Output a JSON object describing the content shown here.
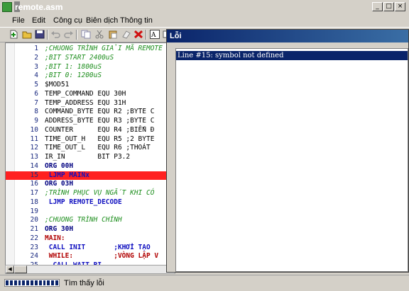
{
  "window": {
    "title": "remote.asm"
  },
  "menu": [
    "File",
    "Edit",
    "Công cụ",
    "Biên dịch",
    "Thông tin"
  ],
  "toolbar": {
    "icons": [
      "new-file-icon",
      "open-folder-icon",
      "save-icon",
      "undo-icon",
      "redo-icon",
      "copy-icon",
      "cut-icon",
      "paste-icon",
      "erase-icon",
      "delete-icon",
      "font-icon",
      "view-icon"
    ]
  },
  "editor": {
    "highlighted_line": 15,
    "lines": [
      {
        "n": "1",
        "t": ";CHUONG TRÌNH GIẢI MÃ REMOTE",
        "s": "cmt"
      },
      {
        "n": "2",
        "t": ";BIT START 2400uS",
        "s": "cmt"
      },
      {
        "n": "3",
        "t": ";BIT 1: 1800uS",
        "s": "cmt"
      },
      {
        "n": "4",
        "t": ";BIT 0: 1200uS",
        "s": "cmt"
      },
      {
        "n": "5",
        "t": "$MOD51",
        "s": "plain"
      },
      {
        "n": "6",
        "t": "TEMP_COMMAND EQU 30H",
        "s": "plain"
      },
      {
        "n": "7",
        "t": "TEMP_ADDRESS EQU 31H",
        "s": "plain"
      },
      {
        "n": "8",
        "t": "COMMAND_BYTE EQU R2 ;BYTE C",
        "s": "plain"
      },
      {
        "n": "9",
        "t": "ADDRESS_BYTE EQU R3 ;BYTE C",
        "s": "plain"
      },
      {
        "n": "10",
        "t": "COUNTER      EQU R4 ;BIẾN Đ",
        "s": "plain"
      },
      {
        "n": "11",
        "t": "TIME_OUT_H   EQU R5 ;2 BYTE",
        "s": "plain"
      },
      {
        "n": "12",
        "t": "TIME_OUT_L   EQU R6 ;THOÁT",
        "s": "plain"
      },
      {
        "n": "13",
        "t": "IR_IN        BIT P3.2",
        "s": "plain"
      },
      {
        "n": "14",
        "t": "ORG 00H",
        "s": "kw"
      },
      {
        "n": "15",
        "t": " LJMP MAINx",
        "s": "jmp"
      },
      {
        "n": "16",
        "t": "ORG 03H",
        "s": "kw"
      },
      {
        "n": "17",
        "t": ";TRÌNH PHỤC VỤ NGẮT KHI CÓ",
        "s": "cmt"
      },
      {
        "n": "18",
        "t": " LJMP REMOTE_DECODE",
        "s": "jmp"
      },
      {
        "n": "19",
        "t": "",
        "s": "plain"
      },
      {
        "n": "20",
        "t": ";CHUONG TRÌNH CHÍNH",
        "s": "cmt"
      },
      {
        "n": "21",
        "t": "ORG 30H",
        "s": "kw"
      },
      {
        "n": "22",
        "t": "MAIN:",
        "s": "lbl"
      },
      {
        "n": "23",
        "t": " CALL INIT       ;KHỞI TẠO",
        "s": "jmp"
      },
      {
        "n": "24",
        "t": " WHILE:          ;VÒNG LẶP V",
        "s": "lbl"
      },
      {
        "n": "25",
        "t": "  CALL WAIT_RI",
        "s": "jmp"
      }
    ]
  },
  "dialog": {
    "title": "Lỗi",
    "message": "Line #15: symbol not defined"
  },
  "status": {
    "text": "Tìm thấy lỗi",
    "progress": 1.0
  }
}
